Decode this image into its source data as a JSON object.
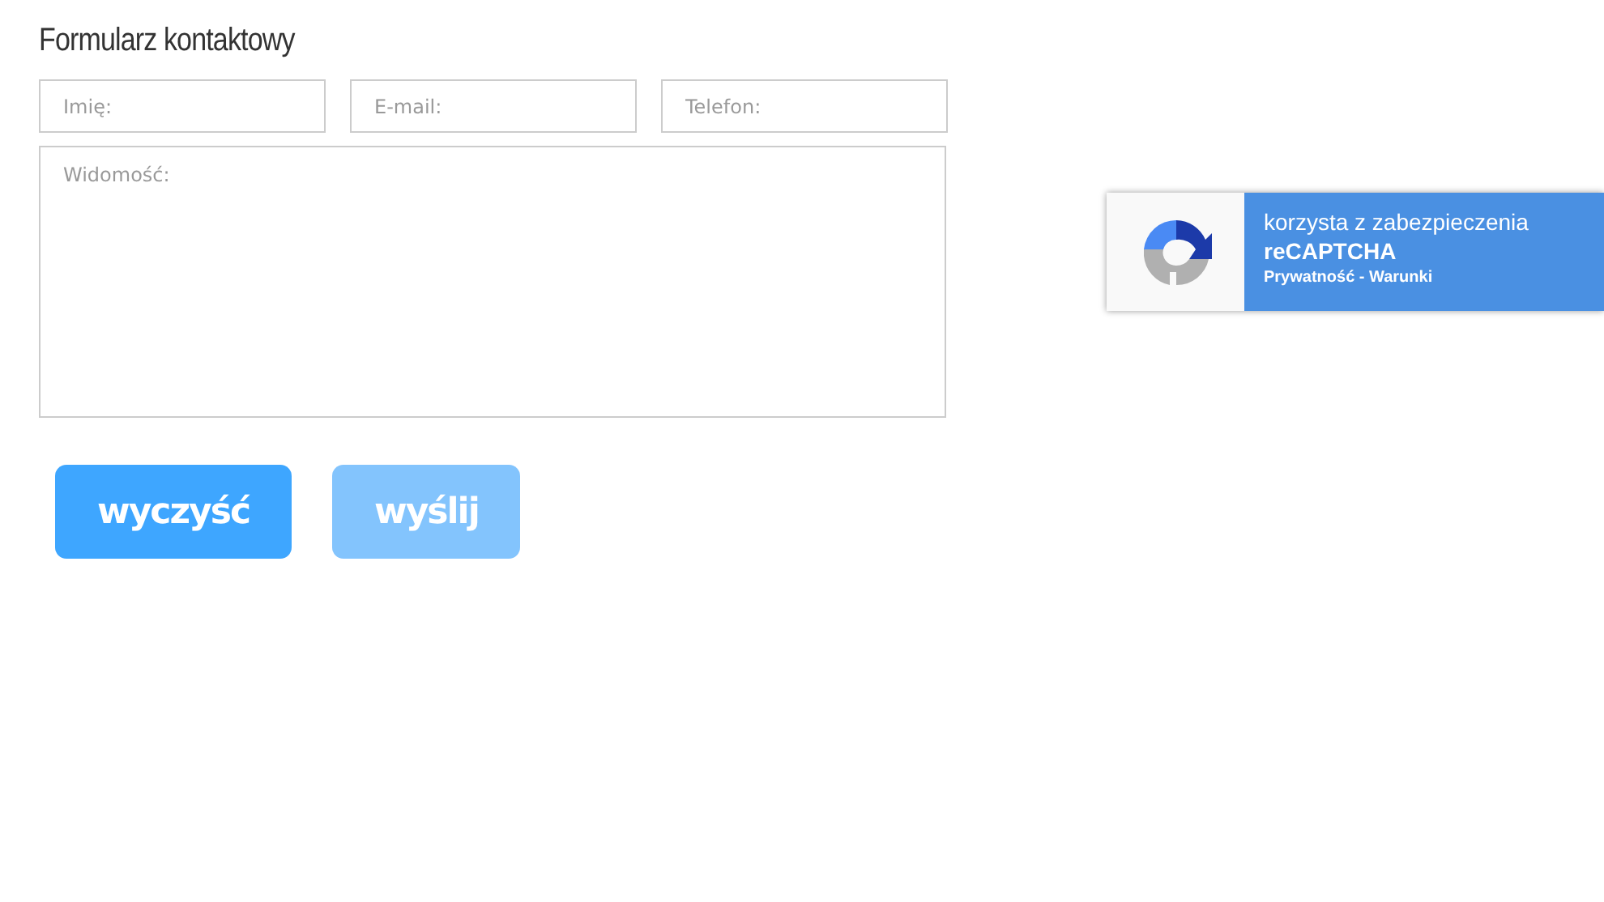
{
  "form": {
    "title": "Formularz kontaktowy",
    "fields": [
      {
        "placeholder": "Imię:"
      },
      {
        "placeholder": "E-mail:"
      },
      {
        "placeholder": "Telefon:"
      }
    ],
    "message": {
      "placeholder": "Widomość:"
    },
    "buttons": [
      {
        "label": "wyczyść",
        "disabled": false
      },
      {
        "label": "wyślij",
        "disabled": true
      }
    ]
  },
  "recaptcha": {
    "line1": "korzysta z zabezpieczenia",
    "line2": "reCAPTCHA",
    "links": "Prywatność - Warunki"
  }
}
